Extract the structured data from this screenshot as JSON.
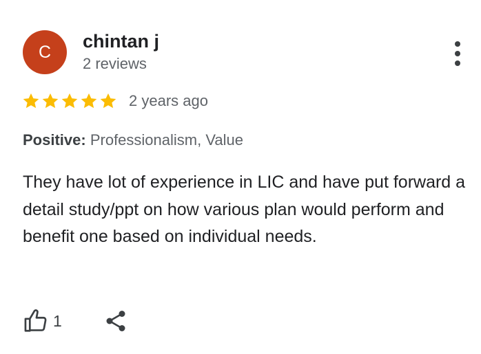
{
  "review": {
    "author": {
      "initial": "C",
      "name": "chintan j",
      "meta": "2 reviews",
      "avatar_color": "#c5401b"
    },
    "rating": {
      "stars": 5,
      "max_stars": 5,
      "star_color": "#fbbc04"
    },
    "time": "2 years ago",
    "highlights": {
      "label": "Positive:",
      "value": "Professionalism, Value"
    },
    "text": "They have lot of experience in LIC and have put forward a detail study/ppt on how various plan would perform and benefit one based on individual needs.",
    "actions": {
      "like_count": "1",
      "like_icon": "thumb-up-icon",
      "share_icon": "share-icon",
      "more_icon": "more-vert-icon"
    }
  }
}
